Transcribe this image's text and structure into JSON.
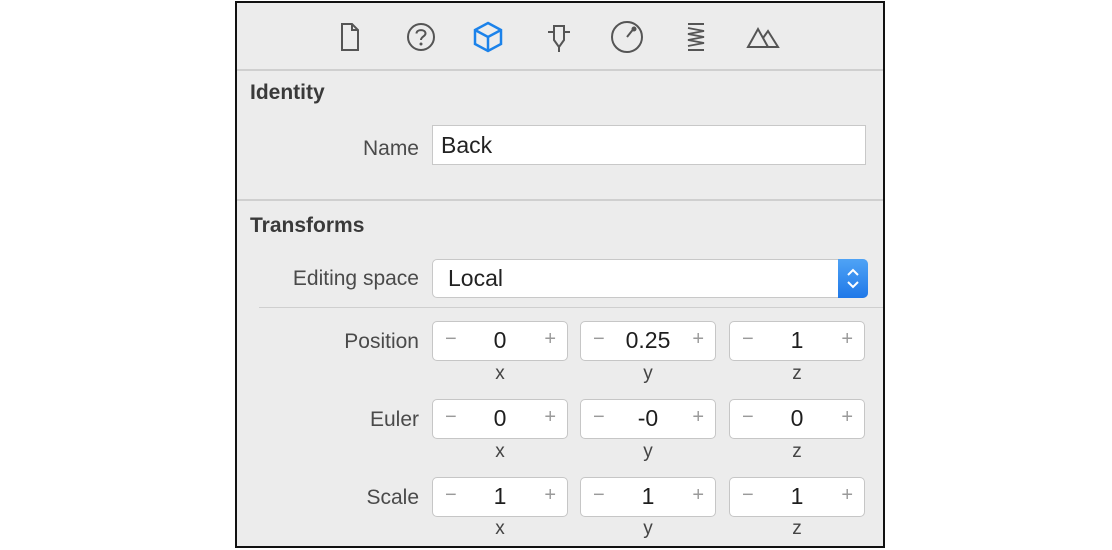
{
  "toolbar": {
    "tabs": [
      {
        "icon": "file-icon",
        "selected": false
      },
      {
        "icon": "help-icon",
        "selected": false
      },
      {
        "icon": "cube-icon",
        "selected": true
      },
      {
        "icon": "attributes-icon",
        "selected": false
      },
      {
        "icon": "physics-icon",
        "selected": false
      },
      {
        "icon": "spring-icon",
        "selected": false
      },
      {
        "icon": "mountains-icon",
        "selected": false
      }
    ],
    "selected_color": "#1b82ea"
  },
  "identity": {
    "title": "Identity",
    "name_label": "Name",
    "name_value": "Back"
  },
  "transforms": {
    "title": "Transforms",
    "editing_space_label": "Editing space",
    "editing_space_value": "Local",
    "stepper_minus": "−",
    "stepper_plus": "+",
    "axis_labels": [
      "x",
      "y",
      "z"
    ],
    "position": {
      "label": "Position",
      "values": [
        "0",
        "0.25",
        "1"
      ]
    },
    "euler": {
      "label": "Euler",
      "values": [
        "0",
        "-0",
        "0"
      ]
    },
    "scale": {
      "label": "Scale",
      "values": [
        "1",
        "1",
        "1"
      ]
    }
  }
}
